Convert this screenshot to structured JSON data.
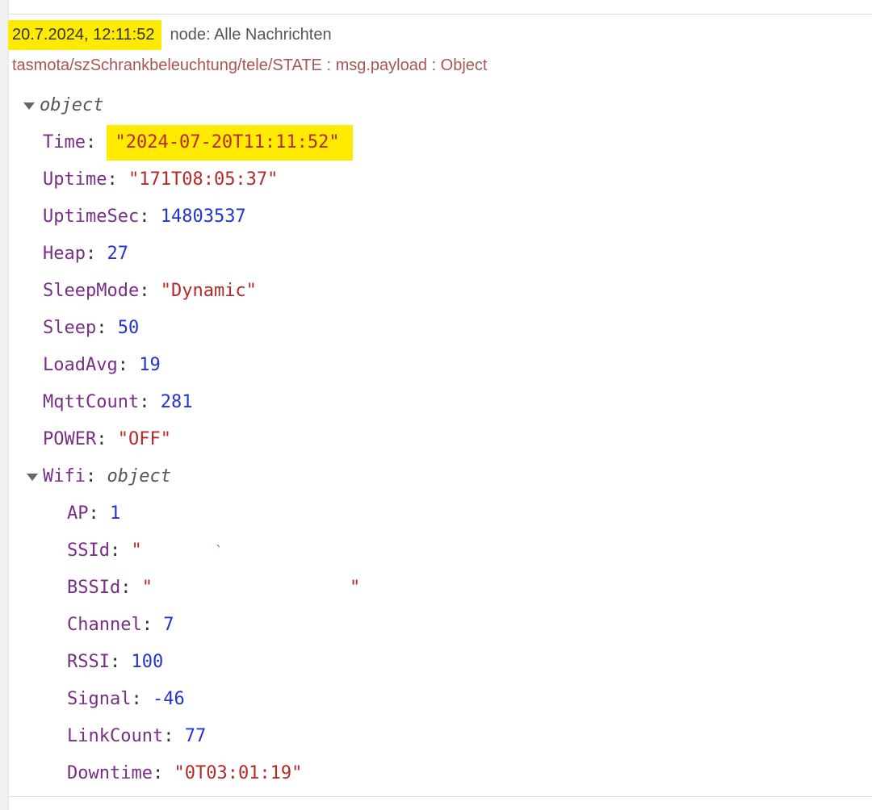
{
  "header": {
    "timestamp": "20.7.2024, 12:11:52",
    "node_label": "node: Alle Nachrichten"
  },
  "topic_line": "tasmota/szSchrankbeleuchtung/tele/STATE : msg.payload : Object",
  "root": {
    "type_label": "object",
    "fields": {
      "time": {
        "key": "Time",
        "value": "\"2024-07-20T11:11:52\""
      },
      "uptime": {
        "key": "Uptime",
        "value": "\"171T08:05:37\""
      },
      "uptime_sec": {
        "key": "UptimeSec",
        "value": "14803537"
      },
      "heap": {
        "key": "Heap",
        "value": "27"
      },
      "sleep_mode": {
        "key": "SleepMode",
        "value": "\"Dynamic\""
      },
      "sleep": {
        "key": "Sleep",
        "value": "50"
      },
      "load_avg": {
        "key": "LoadAvg",
        "value": "19"
      },
      "mqtt_count": {
        "key": "MqttCount",
        "value": "281"
      },
      "power": {
        "key": "POWER",
        "value": "\"OFF\""
      }
    }
  },
  "wifi": {
    "key": "Wifi",
    "type_label": "object",
    "fields": {
      "ap": {
        "key": "AP",
        "value": "1"
      },
      "ssid": {
        "key": "SSId",
        "value_open": "\"",
        "value_close": "`"
      },
      "bssid": {
        "key": "BSSId",
        "value_open": "\"",
        "value_close": "\""
      },
      "channel": {
        "key": "Channel",
        "value": "7"
      },
      "rssi": {
        "key": "RSSI",
        "value": "100"
      },
      "signal": {
        "key": "Signal",
        "value": "-46"
      },
      "link_count": {
        "key": "LinkCount",
        "value": "77"
      },
      "downtime": {
        "key": "Downtime",
        "value": "\"0T03:01:19\""
      }
    }
  }
}
